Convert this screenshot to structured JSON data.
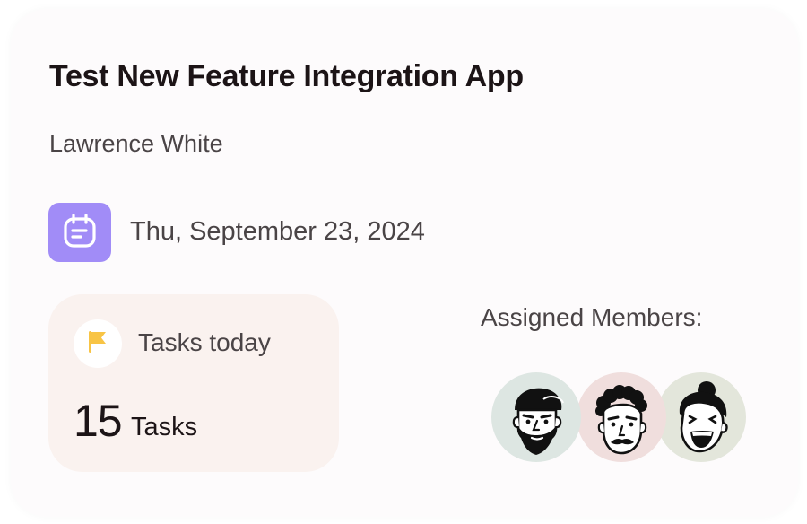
{
  "project": {
    "title": "Test New Feature Integration App",
    "owner": "Lawrence White",
    "date": "Thu, September 23, 2024",
    "calendar_icon": "calendar-icon",
    "accent_color": "#a18cf7"
  },
  "tasks": {
    "label": "Tasks today",
    "count": "15",
    "unit": "Tasks",
    "flag_icon": "flag-icon",
    "flag_color": "#f8c445"
  },
  "members": {
    "label": "Assigned Members:",
    "avatars": [
      {
        "name": "avatar-1",
        "bg": "#dde6e2"
      },
      {
        "name": "avatar-2",
        "bg": "#f0dedd"
      },
      {
        "name": "avatar-3",
        "bg": "#e3e6db"
      }
    ]
  }
}
